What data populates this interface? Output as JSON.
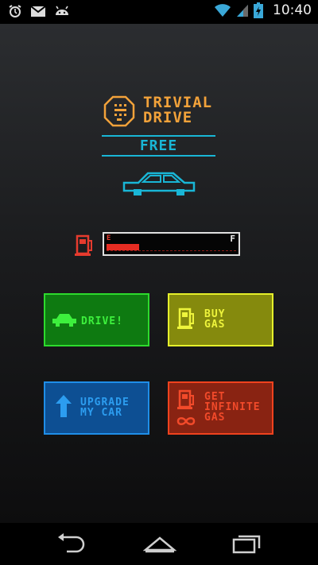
{
  "status_bar": {
    "time": "10:40",
    "left_icons": [
      "alarm-icon",
      "gmail-icon",
      "android-debug-icon"
    ],
    "right_icons": [
      "wifi-icon",
      "cell-signal-icon",
      "battery-charging-icon"
    ]
  },
  "app": {
    "logo_line1": "TRIVIAL",
    "logo_line2": "DRIVE",
    "edition": "FREE",
    "gauge": {
      "empty_label": "E",
      "full_label": "F",
      "level": 0.25,
      "color": "#e52c22"
    },
    "buttons": {
      "drive": {
        "label": "DRIVE!",
        "color": "#2ddb2d"
      },
      "buy_gas": {
        "line1": "BUY",
        "line2": "GAS",
        "color": "#e5f02b"
      },
      "upgrade": {
        "line1": "UPGRADE",
        "line2": "MY CAR",
        "color": "#1f8ee8"
      },
      "infinite_gas": {
        "line1": "GET",
        "line2": "INFINITE",
        "line3": "GAS",
        "color": "#f0421e"
      }
    }
  },
  "nav_bar": {
    "icons": [
      "back-icon",
      "home-icon",
      "recents-icon"
    ]
  }
}
